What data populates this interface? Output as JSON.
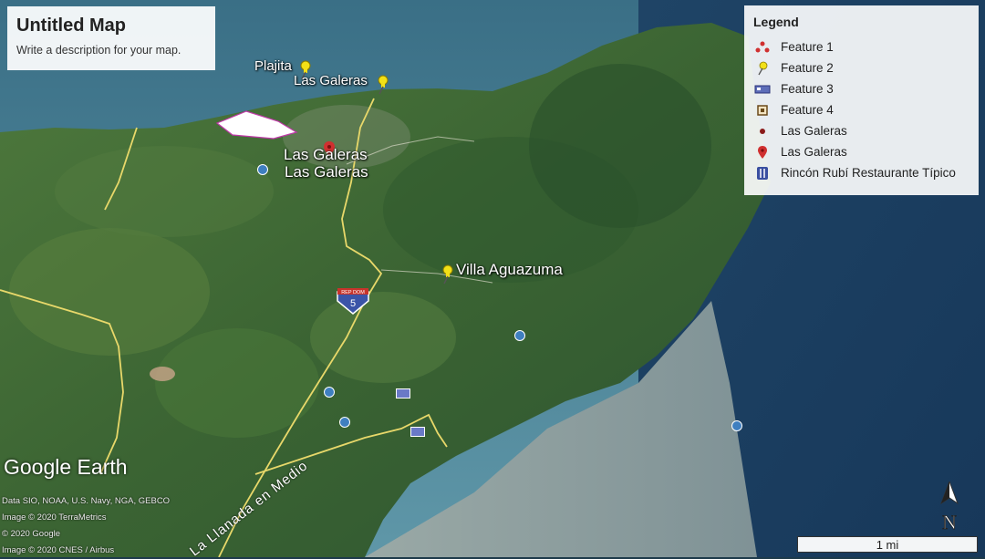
{
  "map": {
    "title": "Untitled Map",
    "description": "Write a description for your map."
  },
  "legend": {
    "title": "Legend",
    "items": [
      {
        "label": "Feature 1",
        "icon": "red-dots-icon"
      },
      {
        "label": "Feature 2",
        "icon": "yellow-pushpin-icon"
      },
      {
        "label": "Feature 3",
        "icon": "lodging-bed-icon"
      },
      {
        "label": "Feature 4",
        "icon": "square-marker-icon"
      },
      {
        "label": "Las Galeras",
        "icon": "dark-red-dot-icon"
      },
      {
        "label": "Las Galeras",
        "icon": "red-location-pin-icon"
      },
      {
        "label": "Rincón Rubí Restaurante Típico",
        "icon": "restaurant-icon"
      }
    ]
  },
  "places": {
    "plajita": "Plajita",
    "las_galeras_beach": "Las Galeras",
    "las_galeras_town_1": "Las Galeras",
    "las_galeras_town_2": "Las Galeras",
    "villa": "Villa Aguazuma",
    "road": "La Llanada en Medio"
  },
  "route_shield": {
    "top": "REP DOM",
    "number": "5"
  },
  "branding": {
    "logo": "Google Earth"
  },
  "credits": [
    "Data SIO, NOAA, U.S. Navy, NGA, GEBCO",
    "Image © 2020 TerraMetrics",
    "© 2020 Google",
    "Image © 2020 CNES / Airbus"
  ],
  "scale": {
    "label": "1 mi"
  },
  "compass": {
    "label": "N"
  },
  "colors": {
    "land": "#3d6b34",
    "sea": "#2a5a78",
    "road": "#e8d86a",
    "pin": "#f2e017"
  }
}
